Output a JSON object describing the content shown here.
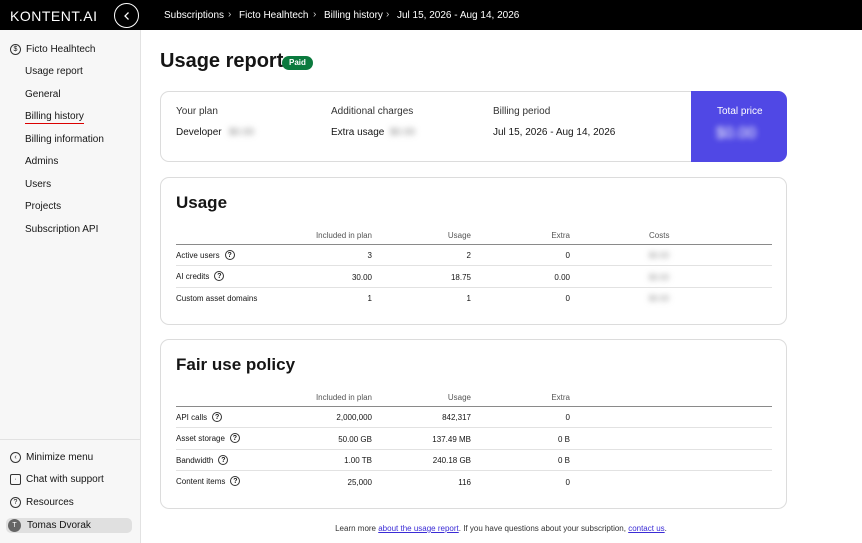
{
  "topbar": {
    "logo": "KONTENT.AI",
    "breadcrumbs": [
      "Subscriptions",
      "Ficto Healhtech",
      "Billing history",
      "Jul 15, 2026 - Aug 14, 2026"
    ],
    "separator": "›"
  },
  "sidebar": {
    "project": "Ficto Healhtech",
    "items": [
      {
        "label": "Usage report",
        "active": false
      },
      {
        "label": "General",
        "active": false
      },
      {
        "label": "Billing history",
        "active": true
      },
      {
        "label": "Billing information",
        "active": false
      },
      {
        "label": "Admins",
        "active": false
      },
      {
        "label": "Users",
        "active": false
      },
      {
        "label": "Projects",
        "active": false
      },
      {
        "label": "Subscription API",
        "active": false
      }
    ],
    "bottom": {
      "minimize": "Minimize menu",
      "chat": "Chat with support",
      "resources": "Resources",
      "user_name": "Tomas Dvorak",
      "user_initial": "T"
    }
  },
  "main": {
    "title": "Usage report",
    "badge": "Paid",
    "summary": {
      "plan_label": "Your plan",
      "plan_name": "Developer",
      "plan_price": "$0.00",
      "additional_label": "Additional charges",
      "extra_label": "Extra usage",
      "extra_price": "$0.00",
      "period_label": "Billing period",
      "period_value": "Jul 15, 2026 - Aug 14, 2026",
      "total_label": "Total price",
      "total_value": "$0.00"
    },
    "usage": {
      "title": "Usage",
      "columns": [
        "Included in plan",
        "Usage",
        "Extra",
        "Costs"
      ],
      "rows": [
        {
          "label": "Active users",
          "included": "3",
          "usage": "2",
          "extra": "0",
          "cost": "$0.00"
        },
        {
          "label": "AI credits",
          "included": "30.00",
          "usage": "18.75",
          "extra": "0.00",
          "cost": "$0.00"
        },
        {
          "label": "Custom asset domains",
          "included": "1",
          "usage": "1",
          "extra": "0",
          "cost": "$0.00"
        }
      ]
    },
    "fair_use": {
      "title": "Fair use policy",
      "columns": [
        "Included in plan",
        "Usage",
        "Extra"
      ],
      "rows": [
        {
          "label": "API calls",
          "included": "2,000,000",
          "usage": "842,317",
          "extra": "0"
        },
        {
          "label": "Asset storage",
          "included": "50.00 GB",
          "usage": "137.49 MB",
          "extra": "0 B"
        },
        {
          "label": "Bandwidth",
          "included": "1.00 TB",
          "usage": "240.18 GB",
          "extra": "0 B"
        },
        {
          "label": "Content items",
          "included": "25,000",
          "usage": "116",
          "extra": "0"
        }
      ]
    },
    "footer": {
      "pre": "Learn more ",
      "link1": "about the usage report",
      "mid": ". If you have questions about your subscription, ",
      "link2": "contact us",
      "post": "."
    }
  },
  "colors": {
    "accent": "#5048e5",
    "badge": "#0b7a3e",
    "active_underline": "#db0000",
    "link": "#3a2bd6"
  }
}
